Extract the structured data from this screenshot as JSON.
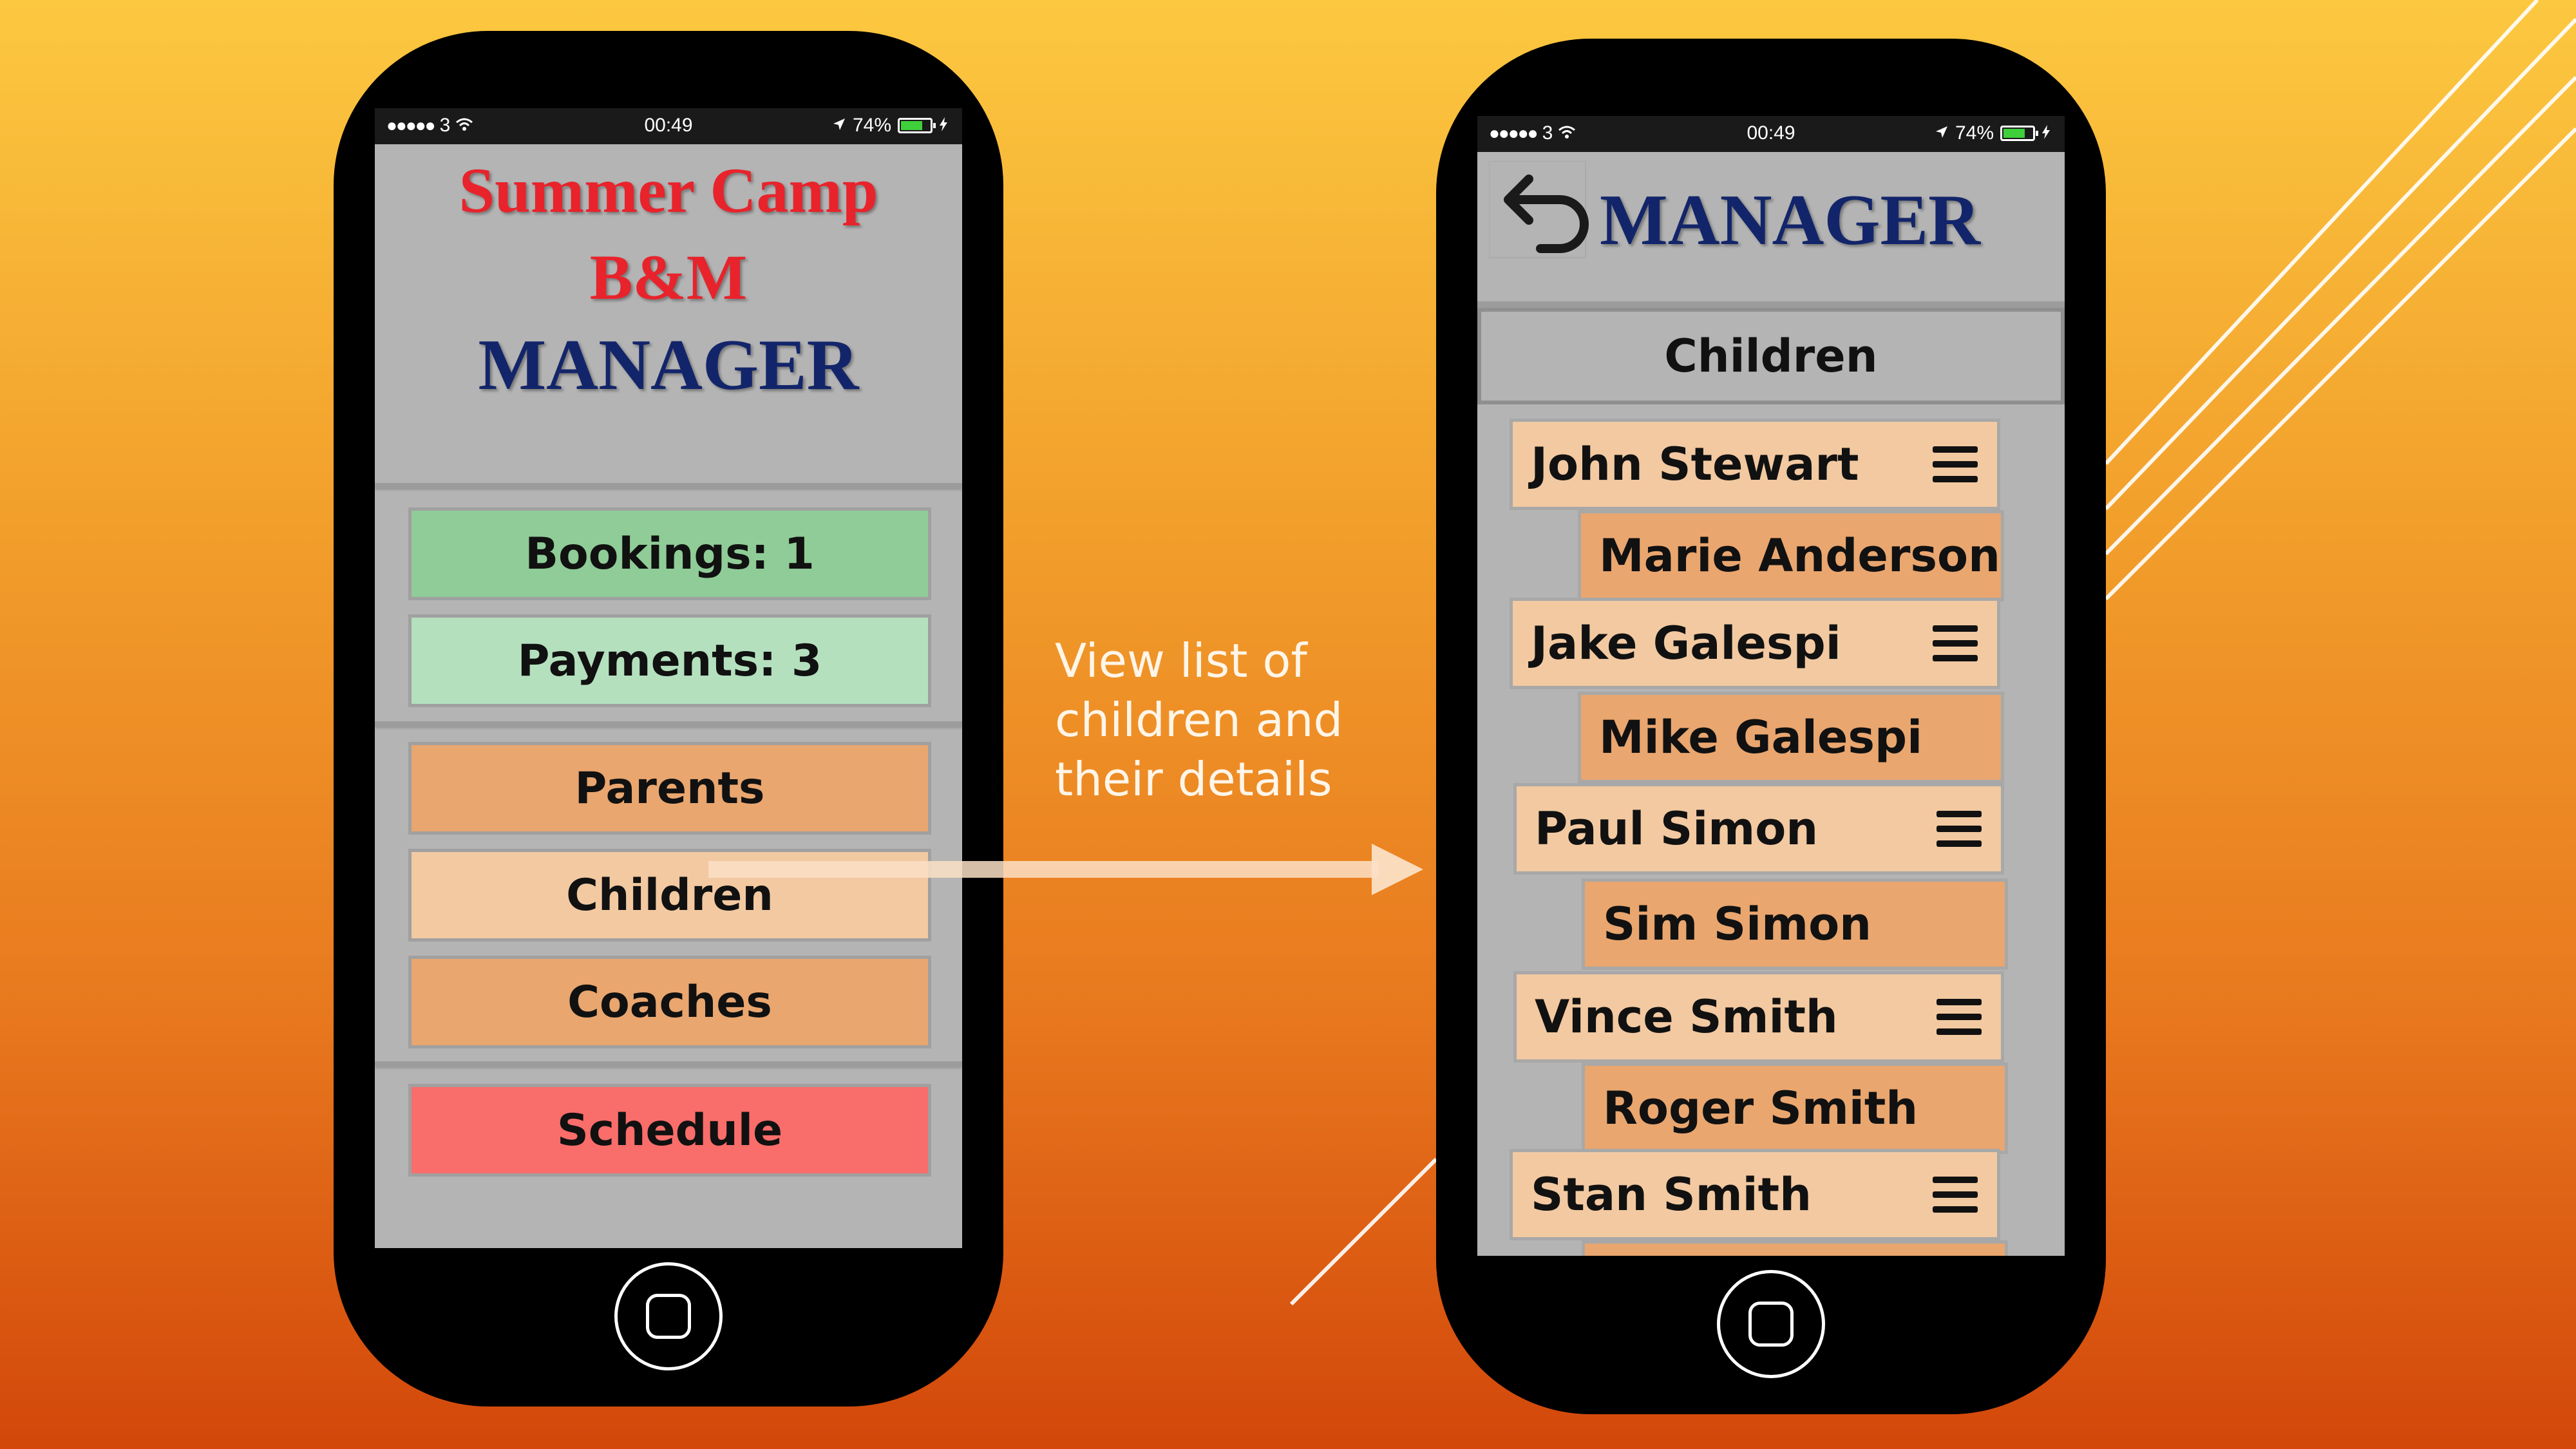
{
  "annotation": {
    "text_line1": "View list of",
    "text_line2": "children and",
    "text_line3": "their details"
  },
  "status_bar": {
    "signal": "●●●●●",
    "carrier": "3",
    "time": "00:49",
    "battery": "74%",
    "battery_level": 0.74
  },
  "left_screen": {
    "title_line1": "Summer Camp",
    "title_line2": "B&M",
    "title_line3": "MANAGER",
    "buttons": [
      {
        "label": "Bookings: 1",
        "color": "#8fcc97"
      },
      {
        "label": "Payments: 3",
        "color": "#b4e0be"
      },
      {
        "label": "Parents",
        "color": "#e9a66f"
      },
      {
        "label": "Children",
        "color": "#f2c9a1"
      },
      {
        "label": "Coaches",
        "color": "#e9a66f"
      },
      {
        "label": "Schedule",
        "color": "#f96d6a"
      }
    ]
  },
  "right_screen": {
    "title": "MANAGER",
    "section_header": "Children",
    "children": [
      {
        "child": "John Stewart",
        "parent": "Marie Anderson"
      },
      {
        "child": "Jake Galespi",
        "parent": "Mike Galespi"
      },
      {
        "child": "Paul Simon",
        "parent": "Sim Simon"
      },
      {
        "child": "Vince Smith",
        "parent": "Roger Smith"
      },
      {
        "child": "Stan Smith",
        "parent": ""
      }
    ]
  },
  "colors": {
    "navy": "#13256a",
    "red": "#e8232b",
    "screen_bg": "#b4b4b4",
    "child_row": "#f2c9a1",
    "parent_row": "#e9a66f"
  },
  "icons": {
    "back": "undo-arrow-icon",
    "row_menu": "hamburger-menu-icon",
    "home": "home-button-icon"
  }
}
